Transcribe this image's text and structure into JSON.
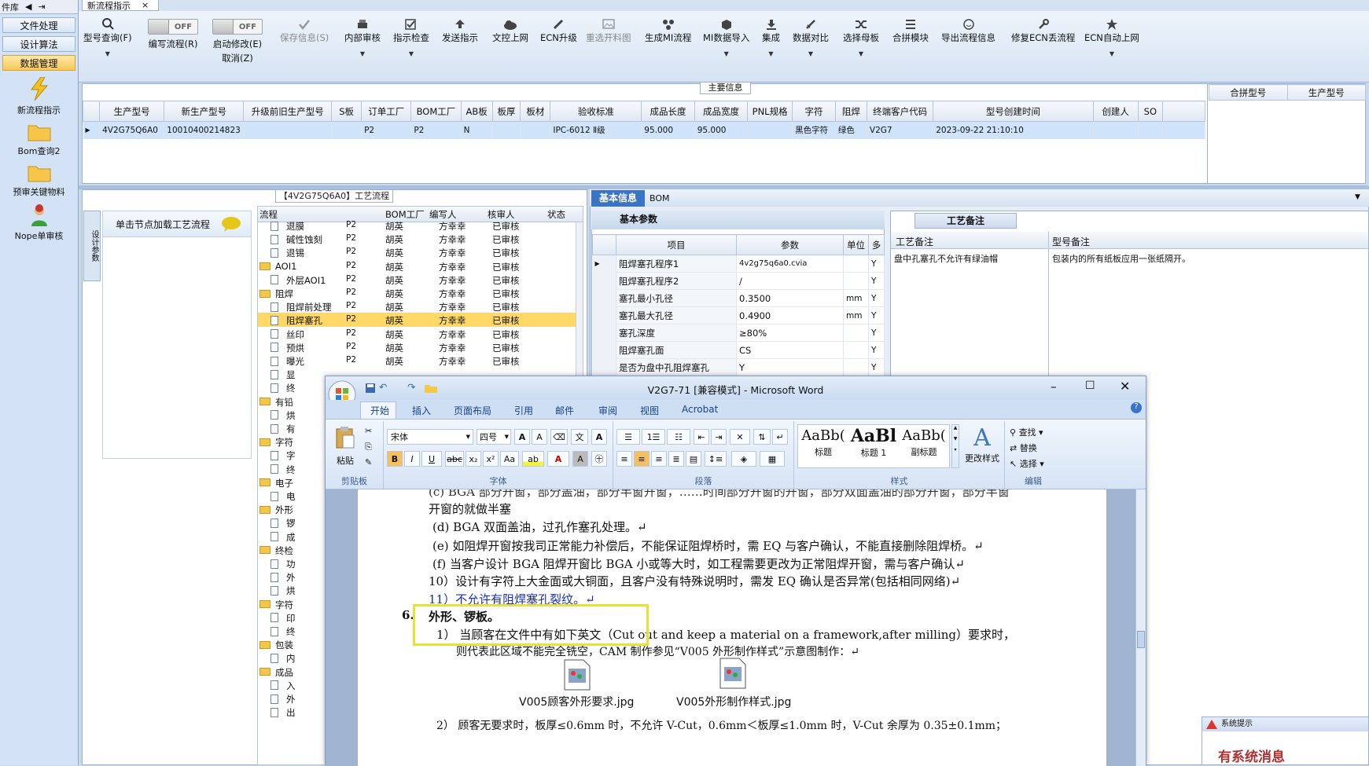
{
  "left_nav": {
    "header": "件库",
    "buttons": [
      "文件处理",
      "设计算法",
      "数据管理"
    ],
    "icons": [
      "新流程指示",
      "Bom查询2",
      "预审关键物料",
      "Nope单审核"
    ]
  },
  "top_tab": {
    "label": "新流程指示",
    "close": "×"
  },
  "toolbar": {
    "items": [
      {
        "label": "型号查询(F)",
        "icon": "search-icon",
        "dropdown": true
      },
      {
        "label": "编写流程(R)",
        "toggle": "OFF"
      },
      {
        "label": "启动修改(E)",
        "sub": "取消(Z)",
        "toggle": "OFF"
      },
      {
        "label": "保存信息(S)",
        "icon": "check-icon",
        "disabled": true
      },
      {
        "label": "内部审核",
        "icon": "printer-icon",
        "dropdown": true
      },
      {
        "label": "指示检查",
        "icon": "check-box-icon",
        "dropdown": true
      },
      {
        "label": "发送指示",
        "icon": "upload-icon"
      },
      {
        "label": "文控上网",
        "icon": "cloud-icon"
      },
      {
        "label": "ECN升级",
        "icon": "pencil-icon"
      },
      {
        "label": "重选开料图",
        "icon": "image-icon",
        "disabled": true
      },
      {
        "label": "生成MI流程",
        "icon": "network-icon"
      },
      {
        "label": "MI数据导入",
        "icon": "cube-icon",
        "dropdown": true
      },
      {
        "label": "集成",
        "icon": "download-icon",
        "dropdown": true
      },
      {
        "label": "数据对比",
        "icon": "sword-icon",
        "dropdown": true
      },
      {
        "label": "选择母板",
        "icon": "shuffle-icon",
        "dropdown": true
      },
      {
        "label": "合拼模块",
        "icon": "list-icon"
      },
      {
        "label": "导出流程信息",
        "icon": "smile-icon"
      },
      {
        "label": "修复ECN丢流程",
        "icon": "wrench-icon"
      },
      {
        "label": "ECN自动上网",
        "icon": "star-icon",
        "dropdown": true
      }
    ]
  },
  "main_info": {
    "label": "主要信息",
    "columns": [
      "生产型号",
      "新生产型号",
      "升级前旧生产型号",
      "S板",
      "订单工厂",
      "BOM工厂",
      "AB板",
      "板厚",
      "板材",
      "验收标准",
      "成品长度",
      "成品宽度",
      "PNL规格",
      "字符",
      "阻焊",
      "终端客户代码",
      "型号创建时间",
      "创建人",
      "SO"
    ],
    "row": [
      "4V2G75Q6A0",
      "10010400214823",
      "",
      "",
      "P2",
      "P2",
      "N",
      "",
      "",
      "IPC-6012 Ⅱ级",
      "95.000",
      "95.000",
      "",
      "黑色字符",
      "绿色",
      "V2G7",
      "2023-09-22 21:10:10",
      "",
      ""
    ],
    "side_columns": [
      "合拼型号",
      "生产型号"
    ]
  },
  "flow": {
    "title": "【4V2G75Q6A0】工艺流程",
    "side_tab": "设计参数",
    "node_hint": "单击节点加载工艺流程",
    "columns": [
      "流程",
      "BOM工厂",
      "编写人",
      "核审人",
      "状态"
    ],
    "rows": [
      {
        "name": "退膜",
        "f": "P2",
        "w": "胡英",
        "r": "方幸幸",
        "s": "已审核",
        "lvl": 2
      },
      {
        "name": "碱性蚀刻",
        "f": "P2",
        "w": "胡英",
        "r": "方幸幸",
        "s": "已审核",
        "lvl": 2
      },
      {
        "name": "退锡",
        "f": "P2",
        "w": "胡英",
        "r": "方幸幸",
        "s": "已审核",
        "lvl": 2
      },
      {
        "name": "AOI1",
        "f": "P2",
        "w": "胡英",
        "r": "方幸幸",
        "s": "已审核",
        "lvl": 1
      },
      {
        "name": "外层AOI1",
        "f": "P2",
        "w": "胡英",
        "r": "方幸幸",
        "s": "已审核",
        "lvl": 2
      },
      {
        "name": "阻焊",
        "f": "P2",
        "w": "胡英",
        "r": "方幸幸",
        "s": "已审核",
        "lvl": 1
      },
      {
        "name": "阻焊前处理",
        "f": "P2",
        "w": "胡英",
        "r": "方幸幸",
        "s": "已审核",
        "lvl": 2
      },
      {
        "name": "阻焊塞孔",
        "f": "P2",
        "w": "胡英",
        "r": "方幸幸",
        "s": "已审核",
        "lvl": 2,
        "sel": true
      },
      {
        "name": "丝印",
        "f": "P2",
        "w": "胡英",
        "r": "方幸幸",
        "s": "已审核",
        "lvl": 2
      },
      {
        "name": "预烘",
        "f": "P2",
        "w": "胡英",
        "r": "方幸幸",
        "s": "已审核",
        "lvl": 2
      },
      {
        "name": "曝光",
        "f": "P2",
        "w": "胡英",
        "r": "方幸幸",
        "s": "已审核",
        "lvl": 2
      },
      {
        "name": "显",
        "f": "",
        "w": "",
        "r": "",
        "s": "",
        "lvl": 2
      },
      {
        "name": "终",
        "f": "",
        "w": "",
        "r": "",
        "s": "",
        "lvl": 2
      },
      {
        "name": "有铅",
        "f": "",
        "w": "",
        "r": "",
        "s": "",
        "lvl": 1
      },
      {
        "name": "烘",
        "f": "",
        "w": "",
        "r": "",
        "s": "",
        "lvl": 2
      },
      {
        "name": "有",
        "f": "",
        "w": "",
        "r": "",
        "s": "",
        "lvl": 2
      },
      {
        "name": "字符",
        "f": "",
        "w": "",
        "r": "",
        "s": "",
        "lvl": 1
      },
      {
        "name": "字",
        "f": "",
        "w": "",
        "r": "",
        "s": "",
        "lvl": 2
      },
      {
        "name": "终",
        "f": "",
        "w": "",
        "r": "",
        "s": "",
        "lvl": 2
      },
      {
        "name": "电子",
        "f": "",
        "w": "",
        "r": "",
        "s": "",
        "lvl": 1
      },
      {
        "name": "电",
        "f": "",
        "w": "",
        "r": "",
        "s": "",
        "lvl": 2
      },
      {
        "name": "外形",
        "f": "",
        "w": "",
        "r": "",
        "s": "",
        "lvl": 1
      },
      {
        "name": "锣",
        "f": "",
        "w": "",
        "r": "",
        "s": "",
        "lvl": 2
      },
      {
        "name": "成",
        "f": "",
        "w": "",
        "r": "",
        "s": "",
        "lvl": 2
      },
      {
        "name": "终检",
        "f": "",
        "w": "",
        "r": "",
        "s": "",
        "lvl": 1
      },
      {
        "name": "功",
        "f": "",
        "w": "",
        "r": "",
        "s": "",
        "lvl": 2
      },
      {
        "name": "外",
        "f": "",
        "w": "",
        "r": "",
        "s": "",
        "lvl": 2
      },
      {
        "name": "烘",
        "f": "",
        "w": "",
        "r": "",
        "s": "",
        "lvl": 2
      },
      {
        "name": "字符",
        "f": "",
        "w": "",
        "r": "",
        "s": "",
        "lvl": 1
      },
      {
        "name": "印",
        "f": "",
        "w": "",
        "r": "",
        "s": "",
        "lvl": 2
      },
      {
        "name": "终",
        "f": "",
        "w": "",
        "r": "",
        "s": "",
        "lvl": 2
      },
      {
        "name": "包装",
        "f": "",
        "w": "",
        "r": "",
        "s": "",
        "lvl": 1
      },
      {
        "name": "内",
        "f": "",
        "w": "",
        "r": "",
        "s": "",
        "lvl": 2
      },
      {
        "name": "成品",
        "f": "",
        "w": "",
        "r": "",
        "s": "",
        "lvl": 1
      },
      {
        "name": "入",
        "f": "",
        "w": "",
        "r": "",
        "s": "",
        "lvl": 2
      },
      {
        "name": "外",
        "f": "",
        "w": "",
        "r": "",
        "s": "",
        "lvl": 2
      },
      {
        "name": "出",
        "f": "",
        "w": "",
        "r": "",
        "s": "",
        "lvl": 2
      }
    ]
  },
  "right": {
    "tabs": [
      "基本信息",
      "BOM"
    ],
    "basic_header": "基本参数",
    "basic_columns": [
      "项目",
      "参数",
      "单位",
      "多"
    ],
    "basic_rows": [
      [
        "阻焊塞孔程序1",
        "4v2g75q6a0.cvia",
        "",
        "Y"
      ],
      [
        "阻焊塞孔程序2",
        "/",
        "",
        "Y"
      ],
      [
        "塞孔最小孔径",
        "0.3500",
        "mm",
        "Y"
      ],
      [
        "塞孔最大孔径",
        "0.4900",
        "mm",
        "Y"
      ],
      [
        "塞孔深度",
        "≥80%",
        "",
        "Y"
      ],
      [
        "阻焊塞孔面",
        "CS",
        "",
        "Y"
      ],
      [
        "是否为盘中孔阻焊塞孔",
        "Y",
        "",
        "Y"
      ]
    ],
    "remarks_tab": "工艺备注",
    "remark_columns": [
      "工艺备注",
      "型号备注"
    ],
    "remark_values": [
      "盘中孔塞孔不允许有绿油帽",
      "包装内的所有纸板应用一张纸隔开。"
    ]
  },
  "word": {
    "title": "V2G7-71 [兼容模式] - Microsoft Word",
    "tabs": [
      "开始",
      "插入",
      "页面布局",
      "引用",
      "邮件",
      "审阅",
      "视图",
      "Acrobat"
    ],
    "font_name": "宋体",
    "font_size": "四号",
    "groups": [
      "剪贴板",
      "字体",
      "段落",
      "样式",
      "编辑"
    ],
    "paste": "粘贴",
    "styles": [
      {
        "sample": "AaBb(",
        "name": "标题"
      },
      {
        "sample": "AaBl",
        "name": "标题 1"
      },
      {
        "sample": "AaBb(",
        "name": "副标题"
      }
    ],
    "change_styles": "更改样式",
    "edit": [
      "查找",
      "替换",
      "选择"
    ],
    "lines": [
      "(c) BGA 部分开窗，部分盖油，部分半窗开窗，……时间部分开窗的开窗，部分双面盖油的部分开窗，部分半窗",
      "开窗的就做半塞",
      "(d) BGA 双面盖油，过孔作塞孔处理。↵",
      "(e) 如阻焊开窗按我司正常能力补偿后，不能保证阻焊桥时，需 EQ 与客户确认，不能直接删除阻焊桥。↵",
      "(f) 当客户设计 BGA 阻焊开窗比 BGA 小或等大时，如工程需要更改为正常阻焊开窗，需与客户确认↵",
      "10）设计有字符上大金面或大铜面，且客户没有特殊说明时，需发 EQ 确认是否异常(包括相同网络)↵",
      "11）不允许有阻焊塞孔裂纹。↵",
      "外形、锣板。",
      "1） 当顾客在文件中有如下英文（Cut out and keep a material on a framework,after milling）要求时，",
      "则代表此区域不能完全铣空，CAM 制作参见“V005 外形制作样式”示意图制作：↵",
      "V005顾客外形要求.jpg",
      "V005外形制作样式.jpg",
      "2） 顾客无要求时，板厚≤0.6mm 时，不允许 V-Cut，0.6mm＜板厚≤1.0mm 时，V-Cut 余厚为 0.35±0.1mm；"
    ],
    "section_num": "6."
  },
  "sys_msg": {
    "title": "系统提示",
    "text": "有系统消息"
  }
}
